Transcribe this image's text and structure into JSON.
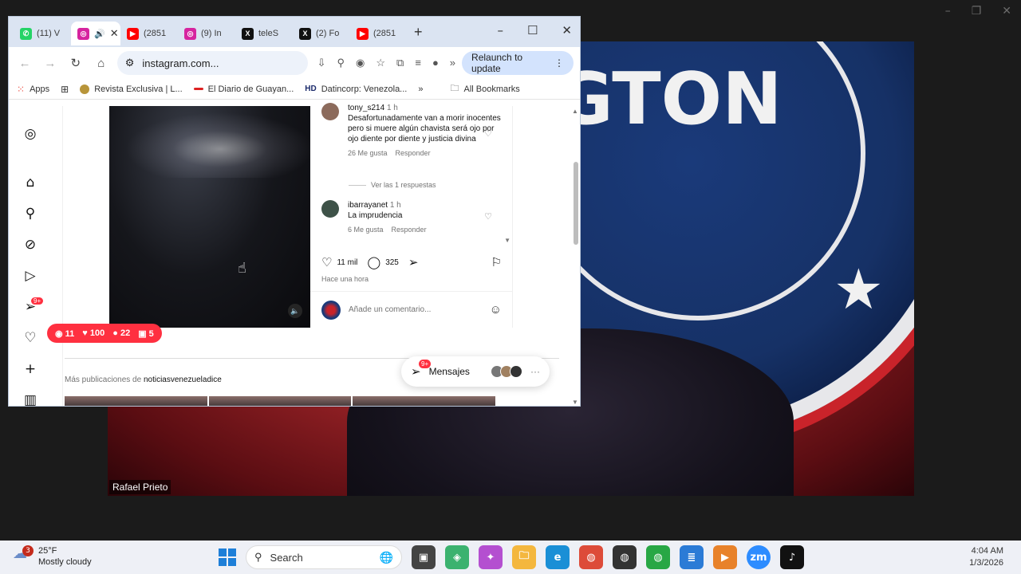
{
  "browser": {
    "tabs": [
      {
        "label": "(11) V",
        "favicon": "whatsapp-icon",
        "color": "#25d366"
      },
      {
        "label": "",
        "favicon": "instagram-icon",
        "color": "#d6249f",
        "active": true
      },
      {
        "label": "(2851",
        "favicon": "youtube-icon",
        "color": "#ff0000"
      },
      {
        "label": "(9) In",
        "favicon": "instagram-icon",
        "color": "#d6249f"
      },
      {
        "label": "teleS",
        "favicon": "x-icon",
        "color": "#111111"
      },
      {
        "label": "(2) Fo",
        "favicon": "x-icon",
        "color": "#111111"
      },
      {
        "label": "(2851",
        "favicon": "youtube-icon",
        "color": "#ff0000"
      }
    ],
    "url": "instagram.com...",
    "relaunch_label": "Relaunch to update",
    "bookmarks": [
      {
        "label": "Apps",
        "icon": "apps-grid-icon"
      },
      {
        "label": "",
        "icon": "grid-icon"
      },
      {
        "label": "Revista Exclusiva | L...",
        "icon": "revista-favicon"
      },
      {
        "label": "El Diario de Guayan...",
        "icon": "diario-favicon"
      },
      {
        "label": "Datincorp: Venezola...",
        "icon": "hd-favicon"
      }
    ],
    "all_bookmarks_label": "All Bookmarks"
  },
  "post": {
    "comments": [
      {
        "user": "tony_s214",
        "time": "1 h",
        "text": "Desafortunadamente van a morir inocentes pero si muere algún chavista será ojo por ojo diente por diente y justicia divina",
        "likes": "26 Me gusta",
        "reply": "Responder"
      },
      {
        "user": "ibarrayanet",
        "time": "1 h",
        "text": "La imprudencia",
        "likes": "6 Me gusta",
        "reply": "Responder"
      }
    ],
    "view_replies": "Ver las 1 respuestas",
    "likes_count": "11 mil",
    "comments_count": "325",
    "time_ago": "Hace una hora",
    "add_comment_placeholder": "Añade un comentario..."
  },
  "notifications": {
    "comments": "11",
    "likes": "100",
    "follows": "22",
    "mentions": "5"
  },
  "rail_badge": "9+",
  "more_posts_prefix": "Más publicaciones de",
  "more_posts_account": "noticiasvenezueladice",
  "messages": {
    "label": "Mensajes",
    "badge": "9+"
  },
  "video_call": {
    "participant_name": "Rafael Prieto"
  },
  "taskbar": {
    "weather_temp": "25°F",
    "weather_desc": "Mostly cloudy",
    "weather_badge": "3",
    "search_label": "Search",
    "time": "4:04 AM",
    "date": "1/3/2026"
  }
}
